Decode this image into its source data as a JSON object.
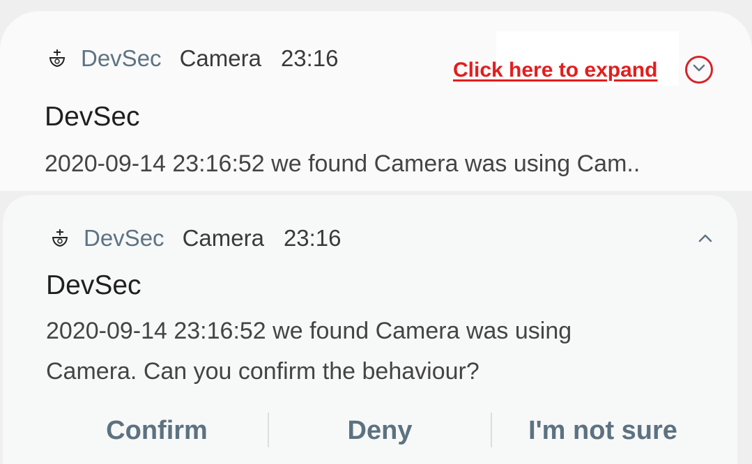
{
  "notification_collapsed": {
    "app_name": "DevSec",
    "sub_text": "Camera",
    "time": "23:16",
    "title": "DevSec",
    "body": "2020-09-14 23:16:52 we found Camera was using Cam..",
    "expand_hint": "Click here to expand",
    "app_icon": "devsec-app-icon",
    "expand_icon": "chevron-down-icon"
  },
  "notification_expanded": {
    "app_name": "DevSec",
    "sub_text": "Camera",
    "time": "23:16",
    "title": "DevSec",
    "body_line1": "2020-09-14 23:16:52 we found Camera was using",
    "body_line2": "Camera. Can you confirm the behaviour?",
    "app_icon": "devsec-app-icon",
    "collapse_icon": "chevron-up-icon",
    "actions": {
      "confirm": "Confirm",
      "deny": "Deny",
      "not_sure": "I'm not sure"
    }
  },
  "colors": {
    "app_name": "#5d7383",
    "action_text": "#5c7280",
    "hint_red": "#e41d1d",
    "card_bg": "#fafafa"
  }
}
